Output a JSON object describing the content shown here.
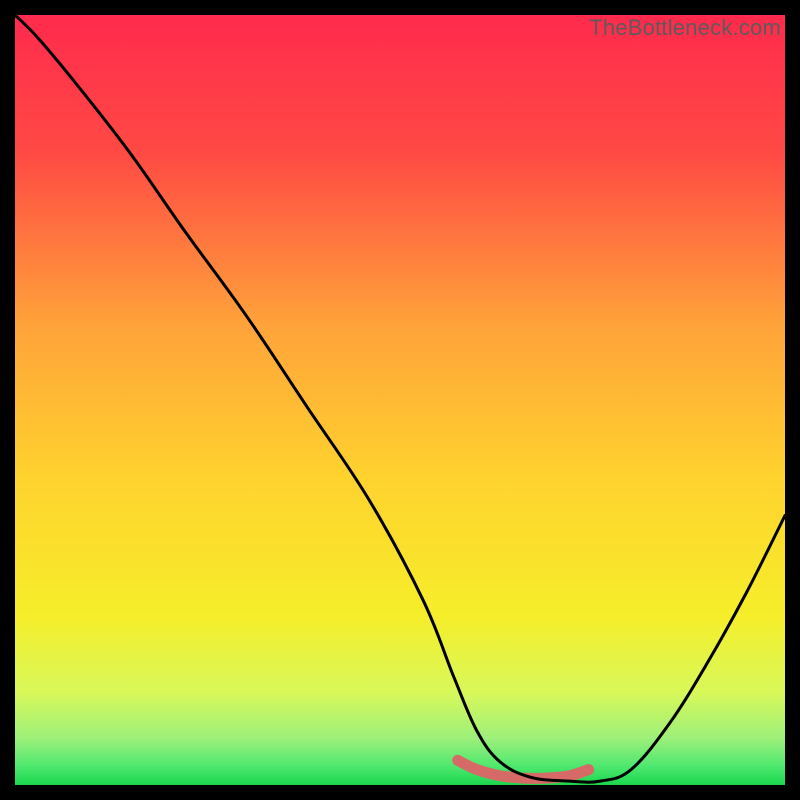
{
  "watermark": "TheBottleneck.com",
  "chart_data": {
    "type": "line",
    "title": "",
    "xlabel": "",
    "ylabel": "",
    "xlim": [
      0,
      100
    ],
    "ylim": [
      0,
      100
    ],
    "gradient_stops": [
      {
        "offset": 0.0,
        "color": "#ff2a4d"
      },
      {
        "offset": 0.18,
        "color": "#ff4a44"
      },
      {
        "offset": 0.4,
        "color": "#ffa23a"
      },
      {
        "offset": 0.6,
        "color": "#ffd22e"
      },
      {
        "offset": 0.78,
        "color": "#f6ee2a"
      },
      {
        "offset": 0.88,
        "color": "#d8f85a"
      },
      {
        "offset": 0.94,
        "color": "#9cf07a"
      },
      {
        "offset": 0.975,
        "color": "#4fe86f"
      },
      {
        "offset": 1.0,
        "color": "#1bd84e"
      }
    ],
    "curve": {
      "x": [
        0.0,
        3,
        8,
        15,
        22,
        30,
        38,
        46,
        53,
        57,
        60,
        63,
        67,
        72,
        76,
        80,
        85,
        90,
        95,
        100
      ],
      "y": [
        100,
        97,
        91,
        82,
        72,
        61,
        49,
        37,
        24,
        14,
        7,
        3,
        1,
        0.5,
        0.5,
        2,
        8,
        16,
        25,
        35
      ]
    },
    "highlight_segment": {
      "color": "#d56a66",
      "width": 11,
      "x": [
        57.5,
        60,
        63,
        66,
        69,
        72,
        74.5
      ],
      "y": [
        3.2,
        2.0,
        1.2,
        0.9,
        0.9,
        1.2,
        2.0
      ]
    }
  }
}
